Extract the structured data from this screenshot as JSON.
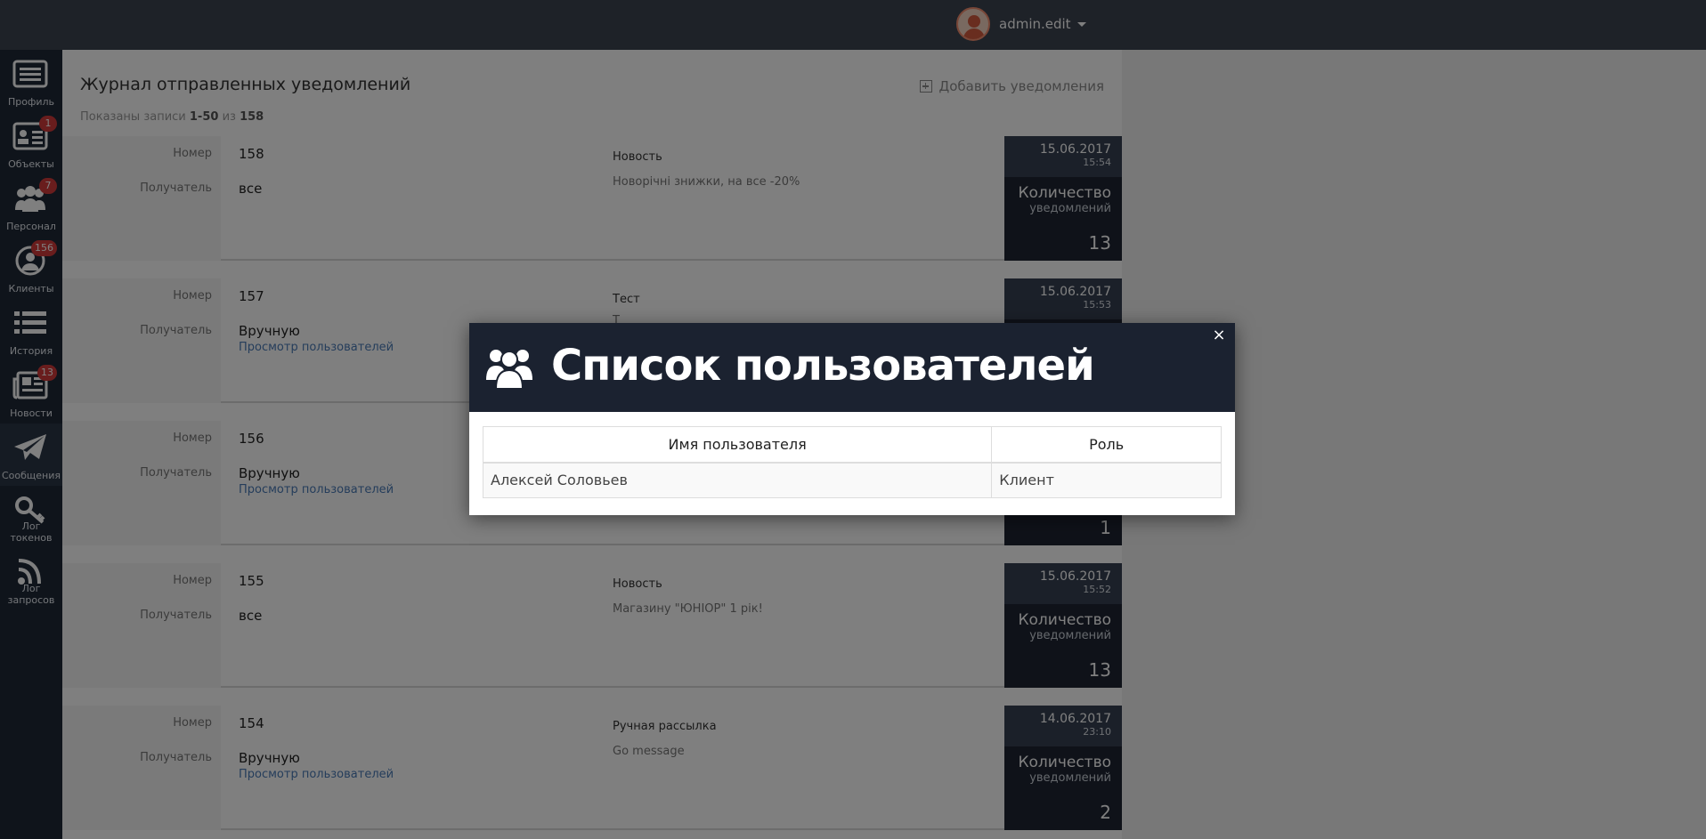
{
  "topbar": {
    "username": "admin.edit"
  },
  "sidebar": {
    "items": [
      {
        "label": "Профиль",
        "icon": "list-icon",
        "badge": ""
      },
      {
        "label": "Объекты",
        "icon": "id-card-icon",
        "badge": "1"
      },
      {
        "label": "Персонал",
        "icon": "users-icon",
        "badge": "7"
      },
      {
        "label": "Клиенты",
        "icon": "user-circle-icon",
        "badge": "156"
      },
      {
        "label": "История",
        "icon": "history-list-icon",
        "badge": ""
      },
      {
        "label": "Новости",
        "icon": "newspaper-icon",
        "badge": "13"
      },
      {
        "label": "Сообщения",
        "icon": "paper-plane-icon",
        "badge": "",
        "active": true
      },
      {
        "label": "Лог токенов",
        "icon": "key-icon",
        "badge": ""
      },
      {
        "label": "Лог запросов",
        "icon": "rss-icon",
        "badge": ""
      }
    ]
  },
  "page": {
    "title": "Журнал отправленных уведомлений",
    "records_prefix": "Показаны записи",
    "records_range": "1-50",
    "records_of": "из",
    "records_total": "158",
    "add_label": "Добавить уведомления"
  },
  "labels": {
    "number": "Номер",
    "recipient": "Получатель",
    "count_title": "Количество",
    "count_sub": "уведомлений"
  },
  "records": [
    {
      "number": "158",
      "recipient": "все",
      "link": "",
      "type": "Новость",
      "text": "Новорічні знижки, на все -20%",
      "date": "15.06.2017",
      "time": "15:54",
      "count": "13"
    },
    {
      "number": "157",
      "recipient": "Вручную",
      "link": "Просмотр пользователей",
      "type": "Тест",
      "text": "Т",
      "date": "15.06.2017",
      "time": "15:53",
      "count": ""
    },
    {
      "number": "156",
      "recipient": "Вручную",
      "link": "Просмотр пользователей",
      "type": "",
      "text": "",
      "date": "",
      "time": "",
      "count": "1"
    },
    {
      "number": "155",
      "recipient": "все",
      "link": "",
      "type": "Новость",
      "text": "Магазину \"ЮНІОР\" 1 рік!",
      "date": "15.06.2017",
      "time": "15:52",
      "count": "13"
    },
    {
      "number": "154",
      "recipient": "Вручную",
      "link": "Просмотр пользователей",
      "type": "Ручная рассылка",
      "text": "Go message",
      "date": "14.06.2017",
      "time": "23:10",
      "count": "2"
    }
  ],
  "modal": {
    "title": "Список пользователей",
    "close": "×",
    "columns": [
      "Имя пользователя",
      "Роль"
    ],
    "rows": [
      {
        "name": "Алексей Соловьев",
        "role": "Клиент"
      }
    ]
  }
}
